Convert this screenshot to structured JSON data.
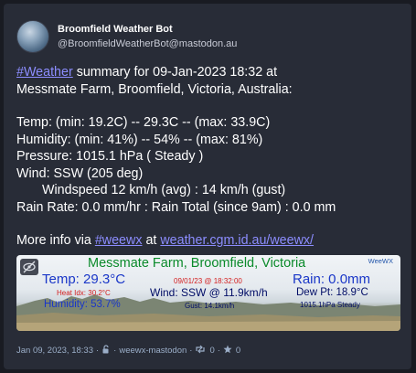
{
  "account": {
    "display_name": "Broomfield Weather Bot",
    "handle": "@BroomfieldWeatherBot@mastodon.au"
  },
  "post": {
    "hashtag_weather": "#Weather",
    "summary_rest": " summary for 09-Jan-2023 18:32 at",
    "location_line": "Messmate Farm, Broomfield, Victoria, Australia:",
    "temp": "Temp: (min: 19.2C) -- 29.3C -- (max: 33.9C)",
    "humidity": "Humidity: (min: 41%) -- 54% -- (max: 81%)",
    "pressure": "Pressure: 1015.1 hPa ( Steady )",
    "wind": "Wind: SSW (205 deg)",
    "wind_speed": "Windspeed 12 km/h (avg) : 14 km/h (gust)",
    "rain": "Rain Rate: 0.0 mm/hr : Rain Total (since 9am) : 0.0 mm",
    "more_info_prefix": "More info via ",
    "hashtag_weewx": "#weewx",
    "more_info_mid": " at ",
    "info_link": "weather.cgm.id.au/weewx/"
  },
  "image": {
    "title": "Messmate Farm, Broomfield, Victoria",
    "brand": "WeeWX",
    "temp": "Temp: 29.3°C",
    "heat_index": "Heat Idx: 30.2°C",
    "humidity": "Humidity: 53.7%",
    "datetime": "09/01/23 @ 18:32:00",
    "wind": "Wind: SSW @ 11.9km/h",
    "gust": "Gust: 14.1km/h",
    "rain": "Rain: 0.0mm",
    "dew_point": "Dew Pt: 18.9°C",
    "pressure": "1015.1hPa Steady"
  },
  "footer": {
    "timestamp": "Jan 09, 2023, 18:33",
    "dot1": "·",
    "app": "weewx-mastodon",
    "dot2": "·",
    "boosts": "0",
    "dot3": "·",
    "favourites": "0"
  },
  "colors": {
    "background": "#191b22",
    "card": "#282c37",
    "link": "#8c8dff",
    "meta_text": "#9baec8",
    "image_title": "#0a8a2a",
    "image_blue": "#1a37c8",
    "image_red": "#d42020"
  }
}
